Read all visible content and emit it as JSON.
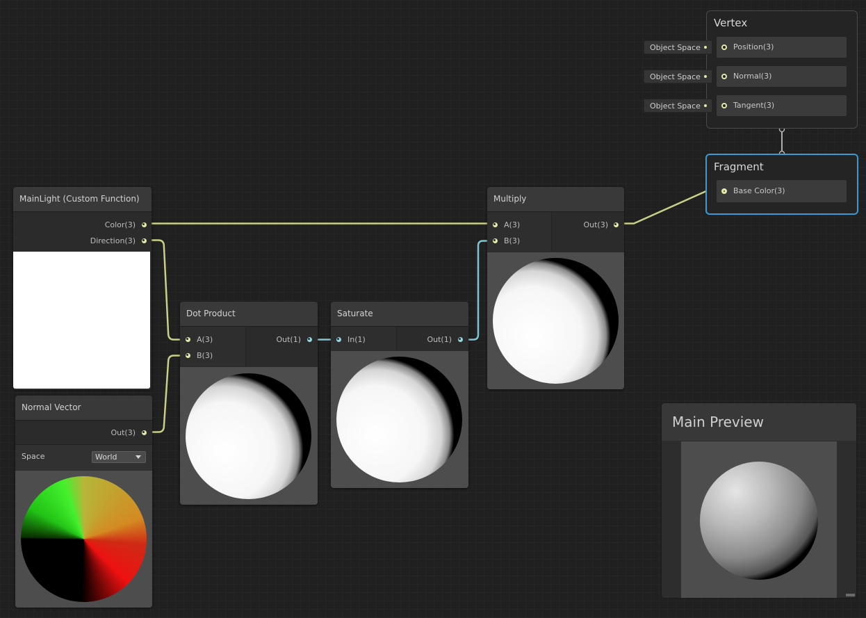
{
  "colors": {
    "background": "#202020",
    "wire_vector3": "#c9d088",
    "wire_vector1": "#7ec6cf",
    "port_vector3": "#e3e9a8",
    "port_vector1": "#93d7e0",
    "selection": "#3a9bd4"
  },
  "vertex": {
    "title": "Vertex",
    "blocks": [
      {
        "label": "Position(3)",
        "input": "Object Space"
      },
      {
        "label": "Normal(3)",
        "input": "Object Space"
      },
      {
        "label": "Tangent(3)",
        "input": "Object Space"
      }
    ]
  },
  "fragment": {
    "title": "Fragment",
    "blocks": [
      {
        "label": "Base Color(3)"
      }
    ]
  },
  "nodes": {
    "main_light": {
      "title": "MainLight (Custom Function)",
      "outputs": [
        "Color(3)",
        "Direction(3)"
      ],
      "preview": "white"
    },
    "normal_vector": {
      "title": "Normal Vector",
      "outputs": [
        "Out(3)"
      ],
      "space_label": "Space",
      "space_value": "World",
      "preview": "normal-sphere"
    },
    "dot_product": {
      "title": "Dot Product",
      "inputs": [
        "A(3)",
        "B(3)"
      ],
      "outputs": [
        "Out(1)"
      ],
      "preview": "lit-sphere"
    },
    "saturate": {
      "title": "Saturate",
      "inputs": [
        "In(1)"
      ],
      "outputs": [
        "Out(1)"
      ],
      "preview": "lit-sphere"
    },
    "multiply": {
      "title": "Multiply",
      "inputs": [
        "A(3)",
        "B(3)"
      ],
      "outputs": [
        "Out(3)"
      ],
      "preview": "lit-sphere"
    }
  },
  "main_preview": {
    "title": "Main Preview"
  }
}
